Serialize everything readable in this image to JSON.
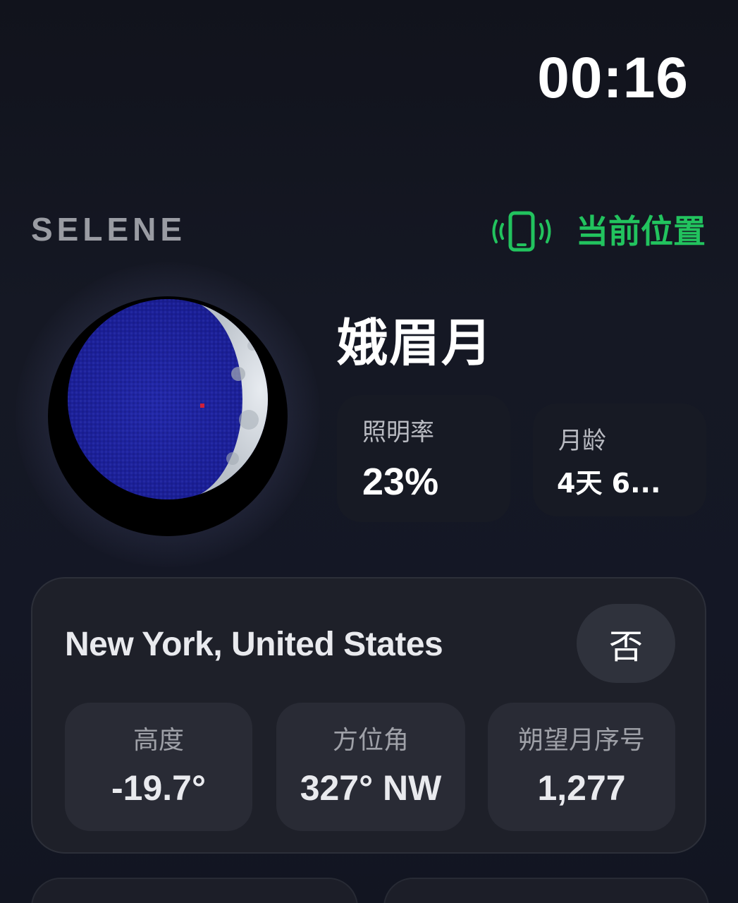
{
  "status_bar": {
    "time": "00:16"
  },
  "header": {
    "app_name": "SELENE",
    "location_button": {
      "label": "当前位置",
      "icon": "phone-vibrate-icon",
      "color": "#22c35e"
    }
  },
  "moon": {
    "icon": "waxing-crescent-moon-icon",
    "phase_name": "娥眉月",
    "illumination": {
      "label": "照明率",
      "value": "23%"
    },
    "age": {
      "label": "月龄",
      "value": "4天 6..."
    }
  },
  "location_card": {
    "title": "New York, United States",
    "toggle_label": "否",
    "stats": [
      {
        "label": "高度",
        "value": "-19.7°"
      },
      {
        "label": "方位角",
        "value": "327° NW"
      },
      {
        "label": "朔望月序号",
        "value": "1,277"
      }
    ]
  }
}
